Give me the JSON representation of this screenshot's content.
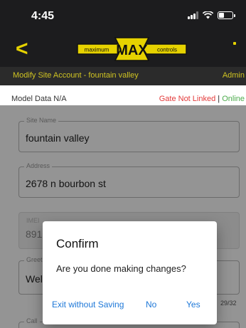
{
  "status_bar": {
    "time": "4:45",
    "signal_icon": "signal-icon",
    "wifi_icon": "wifi-icon",
    "battery_icon": "battery-icon",
    "battery_level": 0.4
  },
  "nav": {
    "back_label": "<",
    "logo": {
      "left": "maximum",
      "center": "MAX",
      "right": "controls"
    }
  },
  "sub_header": {
    "title": "Modify Site Account - fountain valley",
    "user": "Admin"
  },
  "info": {
    "model_data": "Model Data N/A",
    "gate_status": "Gate Not Linked",
    "separator": "|",
    "online_status": "Online"
  },
  "fields": {
    "site_name": {
      "label": "Site Name",
      "value": "fountain valley"
    },
    "address": {
      "label": "Address",
      "value": "2678 n bourbon st"
    },
    "imei": {
      "label": "IMEI",
      "value": "891"
    },
    "greeting": {
      "label": "Greet",
      "value": "Wel",
      "counter": "29/32"
    },
    "call": {
      "label": "Call"
    }
  },
  "dialog": {
    "title": "Confirm",
    "message": "Are you done making changes?",
    "buttons": {
      "exit": "Exit without Saving",
      "no": "No",
      "yes": "Yes"
    }
  },
  "colors": {
    "accent": "#e6d200",
    "sub_text": "#cfc322",
    "gate_red": "#e33a3a",
    "online_green": "#4cab4c",
    "dialog_button": "#1e78d8",
    "dark_bg": "#1c1c1e"
  }
}
